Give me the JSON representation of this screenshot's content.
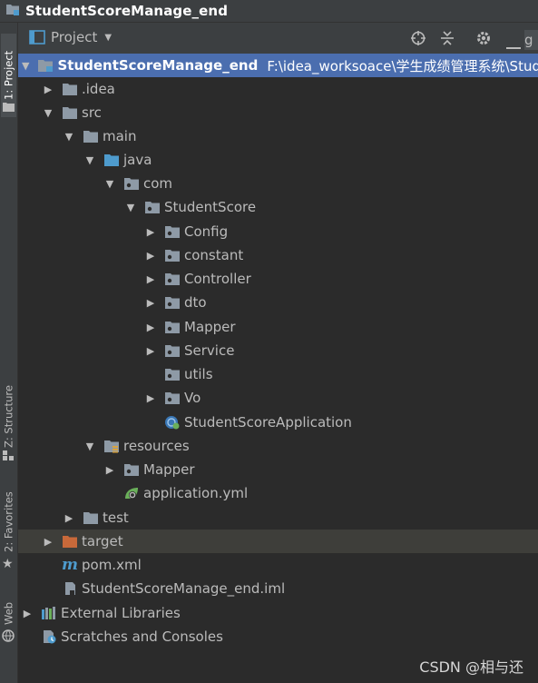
{
  "window": {
    "title": "StudentScoreManage_end"
  },
  "left_strip": {
    "tabs": [
      {
        "label": "1: Project",
        "active": true
      },
      {
        "label": "Z: Structure",
        "active": false
      },
      {
        "label": "2: Favorites",
        "active": false
      },
      {
        "label": "Web",
        "active": false
      }
    ]
  },
  "toolbar": {
    "view_label": "Project",
    "clipped_text": "g"
  },
  "tree": {
    "root_label": "StudentScoreManage_end",
    "root_path": "F:\\idea_worksoace\\学生成绩管理系统\\Stude",
    "idea": ".idea",
    "src": "src",
    "main": "main",
    "java": "java",
    "com": "com",
    "studentscore": "StudentScore",
    "config": "Config",
    "constant": "constant",
    "controller": "Controller",
    "dto": "dto",
    "mapper": "Mapper",
    "service": "Service",
    "utils": "utils",
    "vo": "Vo",
    "app": "StudentScoreApplication",
    "resources": "resources",
    "res_mapper": "Mapper",
    "app_yml": "application.yml",
    "test": "test",
    "target": "target",
    "pom": "pom.xml",
    "iml": "StudentScoreManage_end.iml",
    "ext_libs": "External Libraries",
    "scratches": "Scratches and Consoles"
  },
  "colors": {
    "selection": "#4b6eaf",
    "folder": "#8e9aa6",
    "source_folder": "#4e9bcd",
    "excluded_folder": "#c8693a",
    "spring": "#6aaf5a"
  },
  "watermark": "CSDN @相与还"
}
